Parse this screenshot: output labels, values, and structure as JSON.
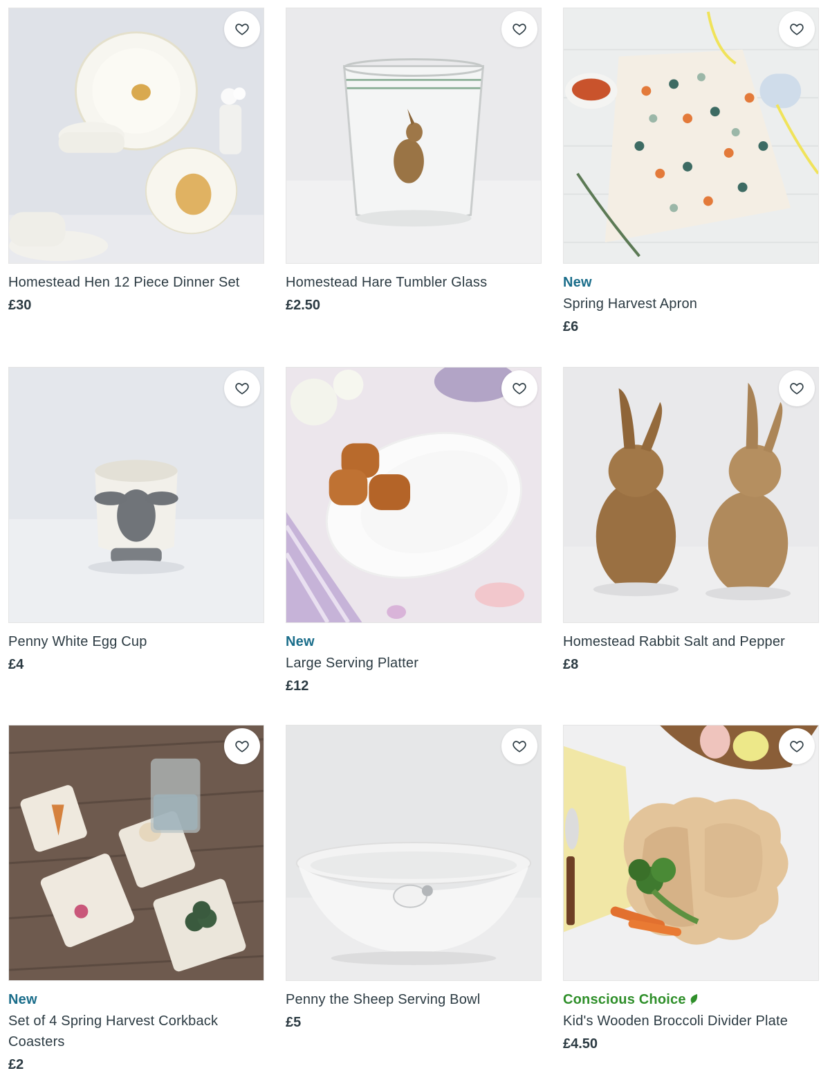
{
  "products": [
    {
      "badge": "",
      "title": "Homestead Hen 12 Piece Dinner Set",
      "price": "£30"
    },
    {
      "badge": "",
      "title": "Homestead Hare Tumbler Glass",
      "price": "£2.50"
    },
    {
      "badge": "New",
      "title": "Spring Harvest Apron",
      "price": "£6"
    },
    {
      "badge": "",
      "title": "Penny White Egg Cup",
      "price": "£4"
    },
    {
      "badge": "New",
      "title": "Large Serving Platter",
      "price": "£12"
    },
    {
      "badge": "",
      "title": "Homestead Rabbit Salt and Pepper",
      "price": "£8"
    },
    {
      "badge": "New",
      "title": "Set of 4 Spring Harvest Corkback Coasters",
      "price": "£2"
    },
    {
      "badge": "",
      "title": "Penny the Sheep Serving Bowl",
      "price": "£5"
    },
    {
      "badge": "Conscious Choice",
      "title": "Kid's Wooden Broccoli Divider Plate",
      "price": "£4.50"
    }
  ],
  "icons": {
    "favourite": "heart-outline-icon",
    "eco": "leaf-icon"
  },
  "colors": {
    "badge_new": "#1a6d8a",
    "badge_conscious": "#2f8f2a",
    "text": "#2b3a42"
  }
}
